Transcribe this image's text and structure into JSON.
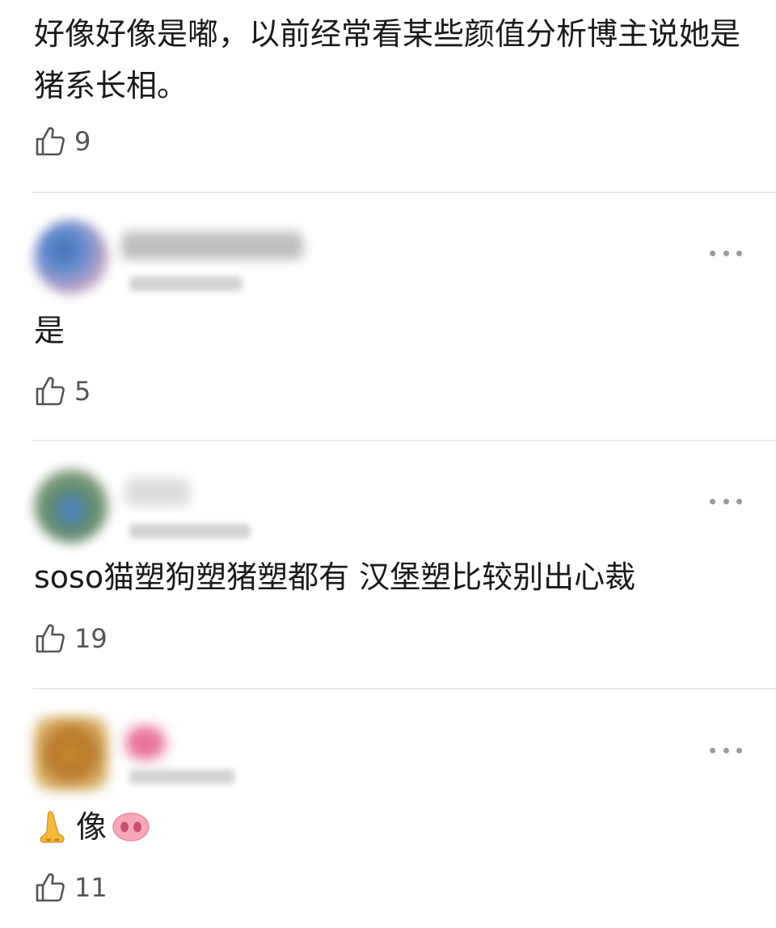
{
  "top_comment": {
    "text": "好像好像是嘟，以前经常看某些颜值分析博主说她是猪系长相。",
    "likes": "9"
  },
  "replies": [
    {
      "text": "是",
      "likes": "5"
    },
    {
      "text": "soso猫塑狗塑猪塑都有 汉堡塑比较别出心裁",
      "likes": "19"
    },
    {
      "text": "像",
      "likes": "11",
      "leading_emoji": "nose-emoji",
      "trailing_emoji": "pig-nose-emoji"
    }
  ],
  "icons": {
    "like": "thumbs-up-outline-icon",
    "more": "more-dots-icon"
  },
  "colors": {
    "text": "#1a1a1a",
    "like_count": "#555555",
    "divider": "#e9e9e9",
    "more_dots": "#9a9a9a"
  }
}
